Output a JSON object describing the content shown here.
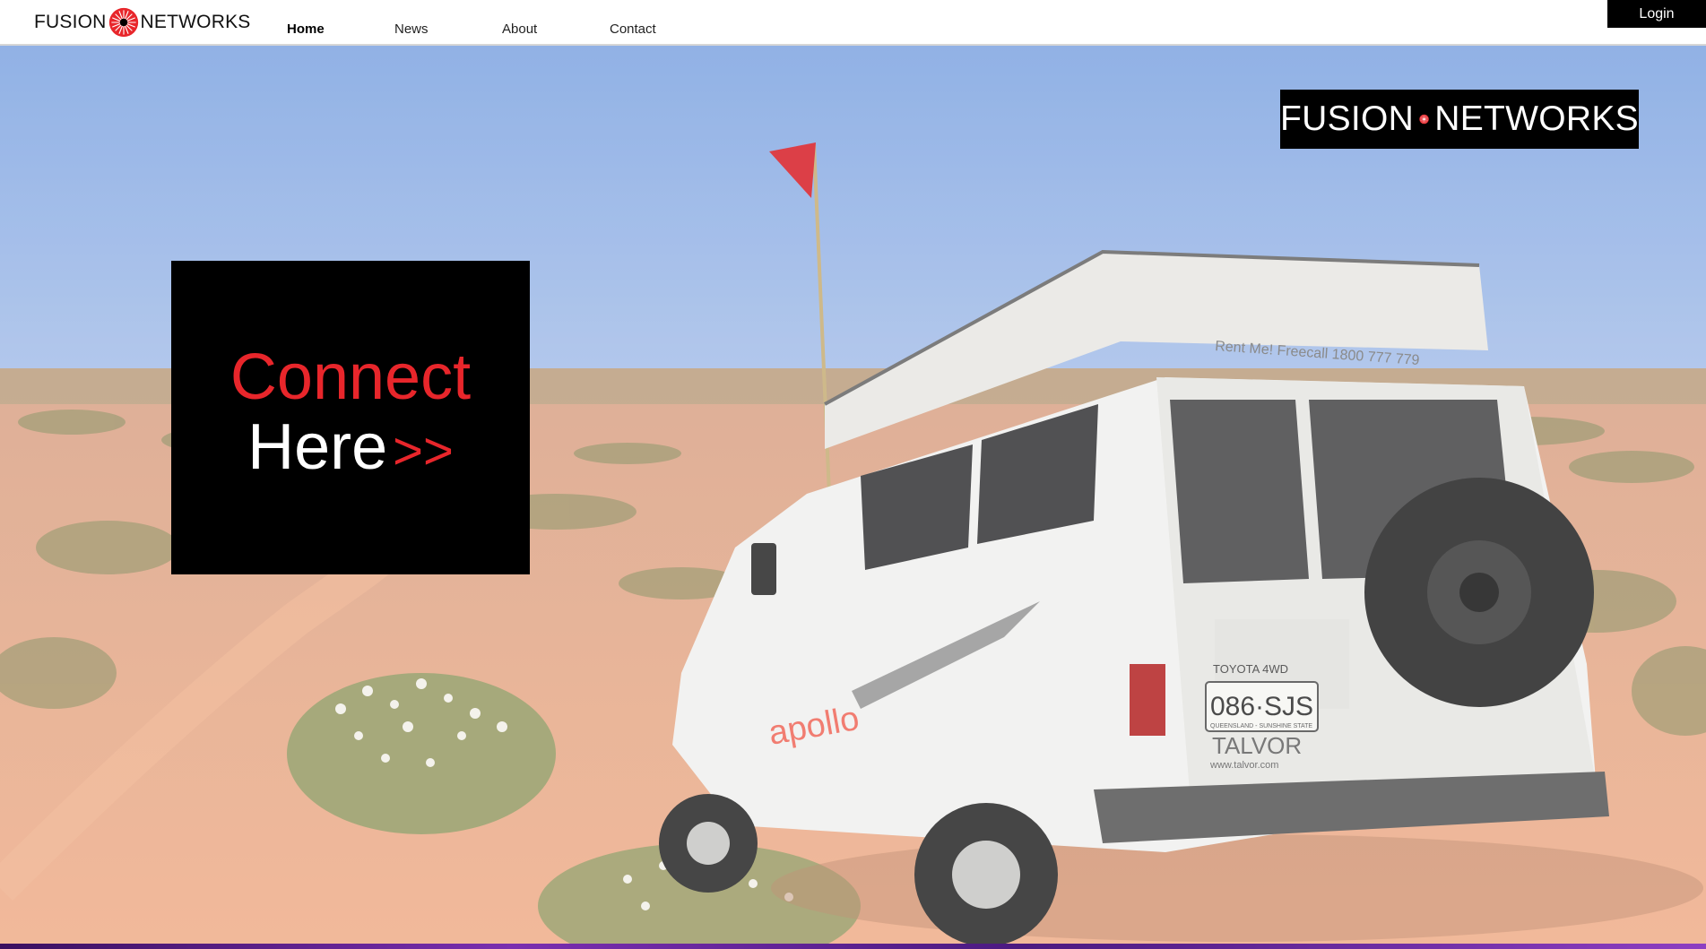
{
  "header": {
    "brand_left": "FUSION",
    "brand_right": "NETWORKS",
    "nav": [
      {
        "label": "Home",
        "active": true
      },
      {
        "label": "News",
        "active": false
      },
      {
        "label": "About",
        "active": false
      },
      {
        "label": "Contact",
        "active": false
      }
    ],
    "login_label": "Login"
  },
  "hero": {
    "logo_left": "FUSION",
    "logo_right": "NETWORKS",
    "cta_line1": "Connect",
    "cta_line2": "Here",
    "cta_arrow": ">>",
    "vehicle_text": {
      "roof_sign": "Rent Me! Freecall 1800 777 779",
      "door_brand": "apollo",
      "badge": "TOYOTA 4WD",
      "plate": "086·SJS",
      "plate_sub": "QUEENSLAND - SUNSHINE STATE",
      "dealer": "TALVOR",
      "dealer_url": "www.talvor.com"
    }
  },
  "colors": {
    "brand_red": "#e8262b",
    "black": "#000000",
    "sky": "#8fb0e6",
    "sand": "#e9a984"
  },
  "icons": {
    "logo_mark": "starburst-icon"
  }
}
